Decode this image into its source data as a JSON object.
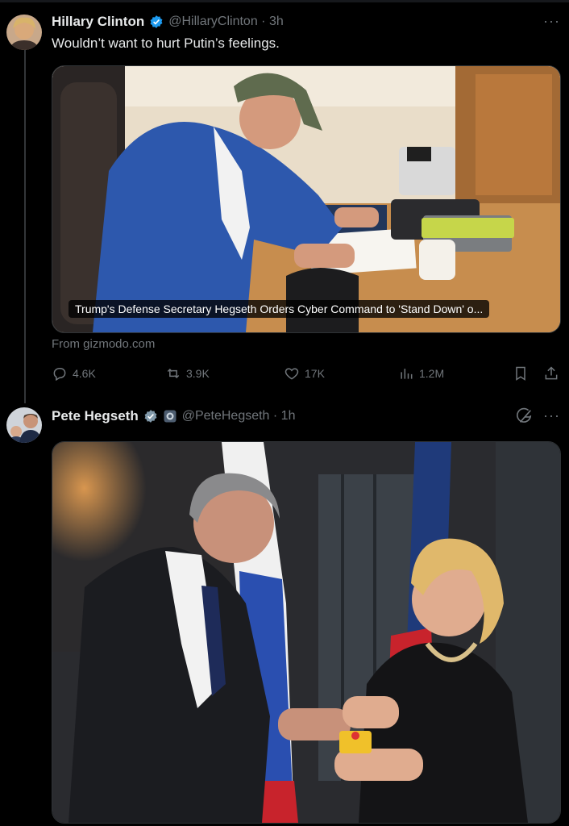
{
  "tweet1": {
    "author_name": "Hillary Clinton",
    "handle_time": "@HillaryClinton · 3h",
    "text": "Wouldn’t want to hurt Putin’s feelings.",
    "card_caption": "Trump's Defense Secretary Hegseth Orders Cyber Command to 'Stand Down' o...",
    "source": "From gizmodo.com",
    "replies": "4.6K",
    "reposts": "3.9K",
    "likes": "17K",
    "views": "1.2M",
    "more": "···"
  },
  "tweet2": {
    "author_name": "Pete Hegseth",
    "handle_time": "@PeteHegseth · 1h",
    "more": "···"
  },
  "colors": {
    "background": "#000000",
    "text": "#e7e9ea",
    "muted": "#71767b",
    "verified_blue": "#1d9bf0",
    "verified_gray": "#829aab"
  },
  "icons": [
    "verified-badge-icon",
    "government-badge-icon",
    "reply-icon",
    "repost-icon",
    "like-icon",
    "views-icon",
    "bookmark-icon",
    "share-icon",
    "grok-icon",
    "more-icon"
  ]
}
